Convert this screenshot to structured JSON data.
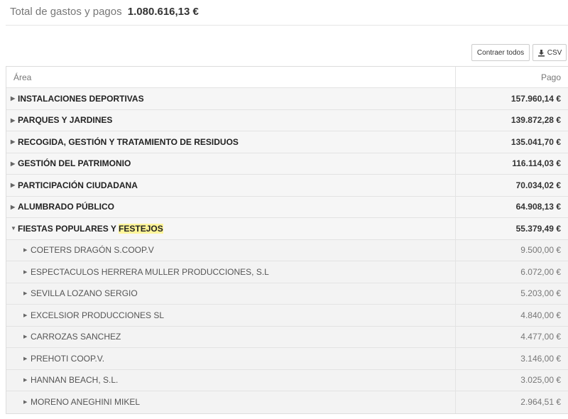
{
  "header": {
    "label": "Total de gastos y pagos",
    "amount": "1.080.616,13 €"
  },
  "toolbar": {
    "collapse_label": "Contraer todos",
    "csv_label": "CSV"
  },
  "table": {
    "columns": [
      "Área",
      "Pago"
    ],
    "groups": [
      {
        "name": "INSTALACIONES DEPORTIVAS",
        "amount": "157.960,14 €"
      },
      {
        "name": "PARQUES Y JARDINES",
        "amount": "139.872,28 €"
      },
      {
        "name": "RECOGIDA, GESTIÓN Y TRATAMIENTO DE RESIDUOS",
        "amount": "135.041,70 €"
      },
      {
        "name": "GESTIÓN DEL PATRIMONIO",
        "amount": "116.114,03 €"
      },
      {
        "name": "PARTICIPACIÓN CIUDADANA",
        "amount": "70.034,02 €"
      },
      {
        "name": "ALUMBRADO PÚBLICO",
        "amount": "64.908,13 €"
      }
    ],
    "expanded": {
      "name_prefix": "FIESTAS POPULARES Y ",
      "name_highlight": "FESTEJOS",
      "amount": "55.379,49 €"
    },
    "items": [
      {
        "name": "COETERS DRAGÓN S.COOP.V",
        "amount": "9.500,00 €"
      },
      {
        "name": "ESPECTACULOS HERRERA MULLER PRODUCCIONES, S.L",
        "amount": "6.072,00 €"
      },
      {
        "name": "SEVILLA LOZANO SERGIO",
        "amount": "5.203,00 €"
      },
      {
        "name": "EXCELSIOR PRODUCCIONES SL",
        "amount": "4.840,00 €"
      },
      {
        "name": "CARROZAS SANCHEZ",
        "amount": "4.477,00 €"
      },
      {
        "name": "PREHOTI COOP.V.",
        "amount": "3.146,00 €"
      },
      {
        "name": "HANNAN BEACH, S.L.",
        "amount": "3.025,00 €"
      },
      {
        "name": "MORENO ANEGHINI MIKEL",
        "amount": "2.964,51 €"
      }
    ]
  },
  "icons": {
    "collapsed_caret": "caret-right-icon",
    "expanded_caret": "caret-down-icon",
    "download": "download-icon"
  }
}
